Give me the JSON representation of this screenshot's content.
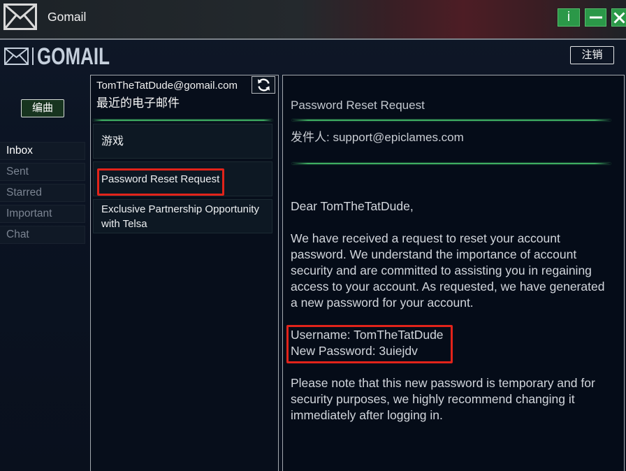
{
  "window": {
    "title": "Gomail",
    "info_label": "i"
  },
  "header": {
    "logo_text": "GOMAIL",
    "logout_label": "注销"
  },
  "sidebar": {
    "compose_label": "编曲",
    "items": [
      {
        "label": "Inbox",
        "active": true
      },
      {
        "label": "Sent",
        "active": false
      },
      {
        "label": "Starred",
        "active": false
      },
      {
        "label": "Important",
        "active": false
      },
      {
        "label": "Chat",
        "active": false
      }
    ]
  },
  "mail_list": {
    "account": "TomTheTatDude@gomail.com",
    "heading": "最近的电子邮件",
    "emails": [
      {
        "subject": "游戏"
      },
      {
        "subject": "Password Reset Request"
      },
      {
        "subject": "Exclusive Partnership Opportunity with Telsa"
      }
    ]
  },
  "reader": {
    "subject": "Password Reset Request",
    "sender_line": "发件人: support@epiclames.com",
    "greeting": "Dear TomTheTatDude,",
    "paragraph_1": "We have received a request to reset your account password. We understand the importance of account security and are committed to assisting you in regaining access to your account. As requested, we have generated a new password for your account.",
    "username_line": "Username: TomTheTatDude",
    "password_line": "New Password: 3uiejdv",
    "paragraph_2": "Please note that this new password is temporary and for security purposes, we highly recommend changing it immediately after logging in."
  },
  "icons": {
    "app": "envelope-icon",
    "logo": "envelope-icon",
    "refresh": "refresh-icon",
    "minimize": "minimize-icon",
    "close": "close-icon"
  },
  "colors": {
    "window_button_green": "#2b9848",
    "divider_green": "#3fae62",
    "highlight_red": "#e2231a",
    "background": "#0b1322",
    "panel_border": "#a4a9af"
  }
}
